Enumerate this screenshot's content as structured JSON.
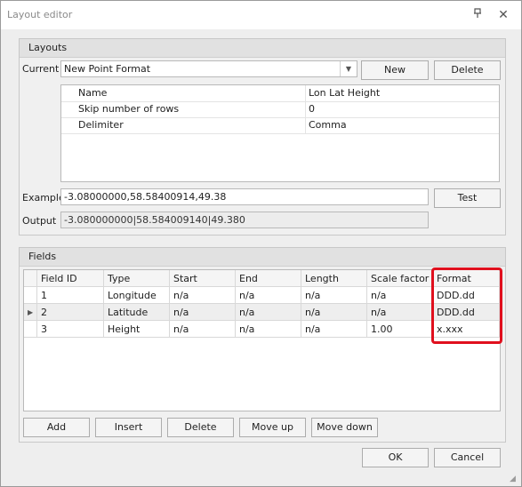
{
  "window": {
    "title": "Layout editor"
  },
  "layouts": {
    "group_title": "Layouts",
    "current_label": "Current",
    "current_value": "New Point Format",
    "new_label": "New",
    "delete_label": "Delete",
    "properties": [
      {
        "name": "Name",
        "value": "Lon Lat Height"
      },
      {
        "name": "Skip number of rows",
        "value": "0"
      },
      {
        "name": "Delimiter",
        "value": "Comma"
      }
    ],
    "example_label": "Example",
    "example_value": "-3.08000000,58.58400914,49.38",
    "test_label": "Test",
    "output_label": "Output",
    "output_value": "-3.080000000|58.584009140|49.380"
  },
  "fields": {
    "group_title": "Fields",
    "columns": [
      "Field ID",
      "Type",
      "Start",
      "End",
      "Length",
      "Scale factor",
      "Format"
    ],
    "rows": [
      [
        "1",
        "Longitude",
        "n/a",
        "n/a",
        "n/a",
        "n/a",
        "DDD.dd"
      ],
      [
        "2",
        "Latitude",
        "n/a",
        "n/a",
        "n/a",
        "n/a",
        "DDD.dd"
      ],
      [
        "3",
        "Height",
        "n/a",
        "n/a",
        "n/a",
        "1.00",
        "x.xxx"
      ]
    ],
    "selected_row": 1,
    "buttons": {
      "add": "Add",
      "insert": "Insert",
      "delete": "Delete",
      "move_up": "Move up",
      "move_down": "Move down"
    }
  },
  "footer": {
    "ok_label": "OK",
    "cancel_label": "Cancel"
  },
  "colors": {
    "highlight": "#e0101e"
  }
}
